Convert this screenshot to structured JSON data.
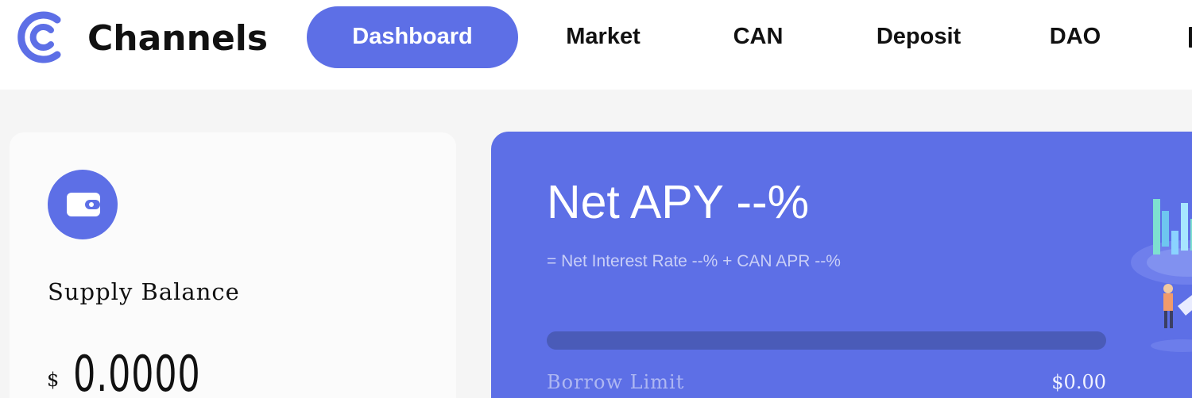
{
  "brand": {
    "name": "Channels",
    "accent": "#5d6fe6"
  },
  "nav": {
    "items": [
      {
        "label": "Dashboard",
        "active": true
      },
      {
        "label": "Market"
      },
      {
        "label": "CAN"
      },
      {
        "label": "Deposit"
      },
      {
        "label": "DAO"
      }
    ]
  },
  "supply": {
    "icon": "wallet-icon",
    "label": "Supply Balance",
    "currency": "$",
    "value": "0.0000"
  },
  "apy": {
    "title": "Net APY --%",
    "formula": "= Net Interest Rate --% + CAN APR --%",
    "borrow_limit_label": "Borrow Limit",
    "borrow_limit_value": "$0.00",
    "borrow_limit_fraction": 0
  }
}
